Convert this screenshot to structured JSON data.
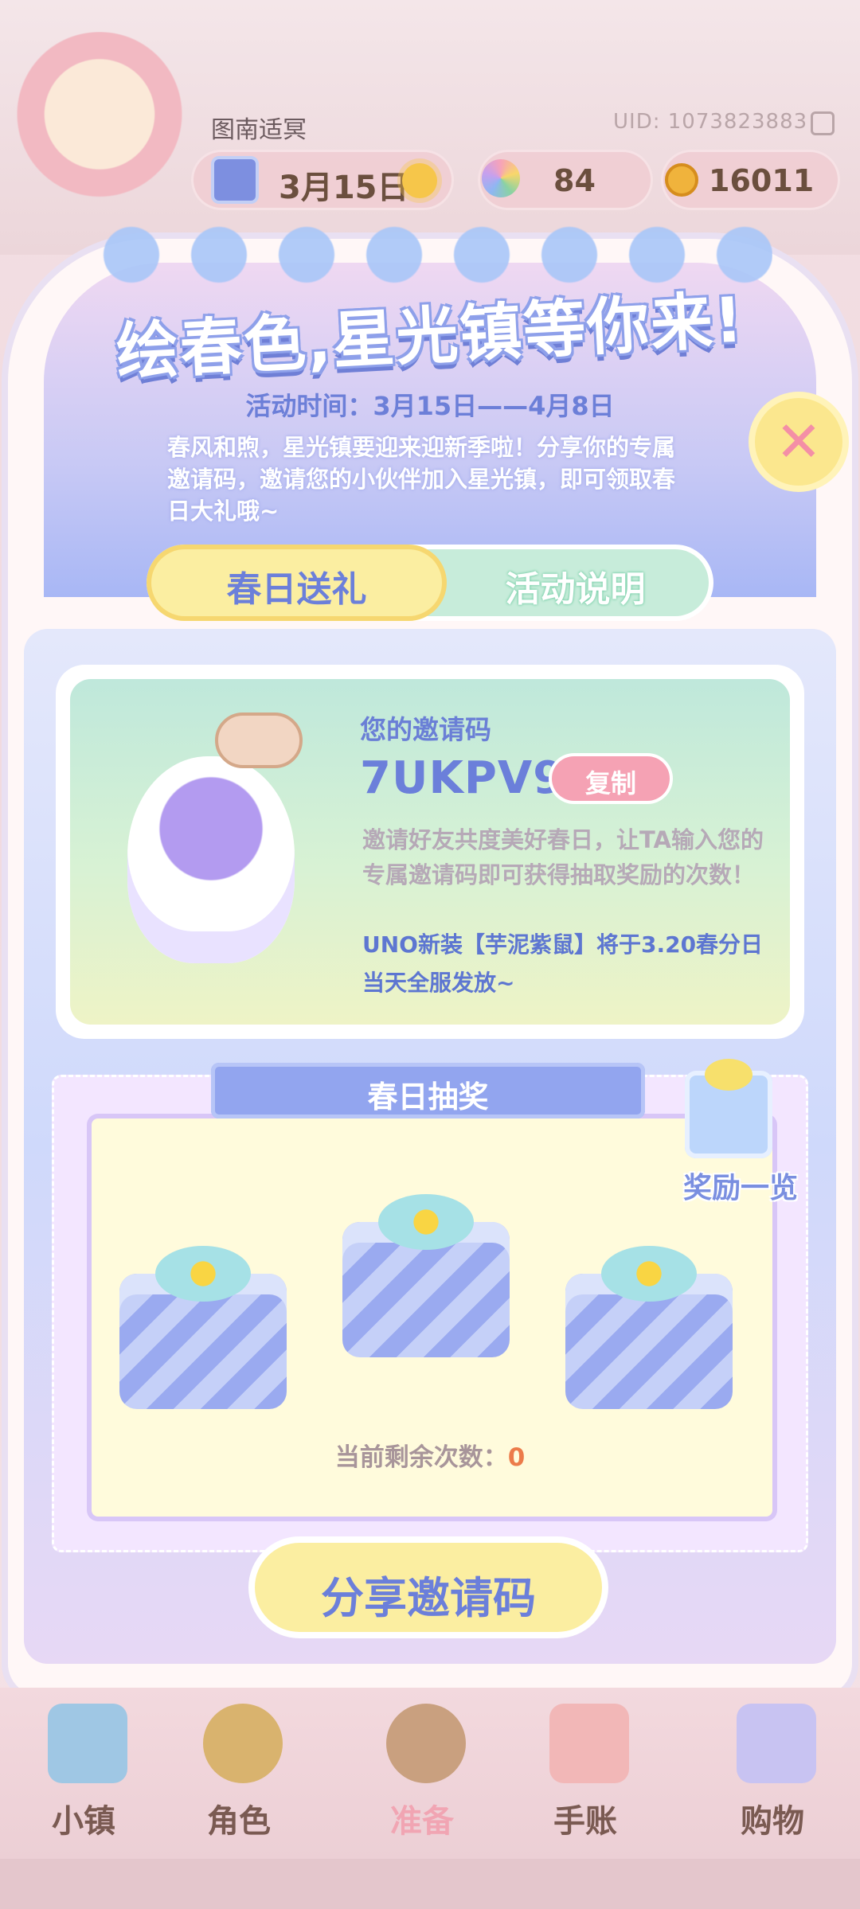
{
  "header": {
    "player_name": "图南适冥",
    "uid": "UID: 1073823883",
    "date": "3月15日",
    "stars": "84",
    "coins": "16011"
  },
  "event": {
    "title": "绘春色,星光镇等你来!",
    "time": "活动时间：3月15日——4月8日",
    "intro": "春风和煦，星光镇要迎来迎新季啦！分享你的专属邀请码，邀请您的小伙伴加入星光镇，即可领取春日大礼哦~"
  },
  "tabs": [
    "春日送礼",
    "活动说明"
  ],
  "invite": {
    "label": "您的邀请码",
    "code": "7UKPV9",
    "copy_label": "复制",
    "description": "邀请好友共度美好春日，让TA输入您的专属邀请码即可获得抽取奖励的次数！",
    "note": "UNO新装【芋泥紫鼠】将于3.20春分日当天全服发放~"
  },
  "lottery": {
    "title": "春日抽奖",
    "reward_label": "奖励一览",
    "remaining_label": "当前剩余次数：",
    "remaining_count": "0"
  },
  "share_button": "分享邀请码",
  "nav": [
    "小镇",
    "角色",
    "准备",
    "手账",
    "购物"
  ],
  "colors": {
    "accent": "#6b7fda",
    "copy_button": "#f5a2b4",
    "share_button": "#fbeea1"
  }
}
